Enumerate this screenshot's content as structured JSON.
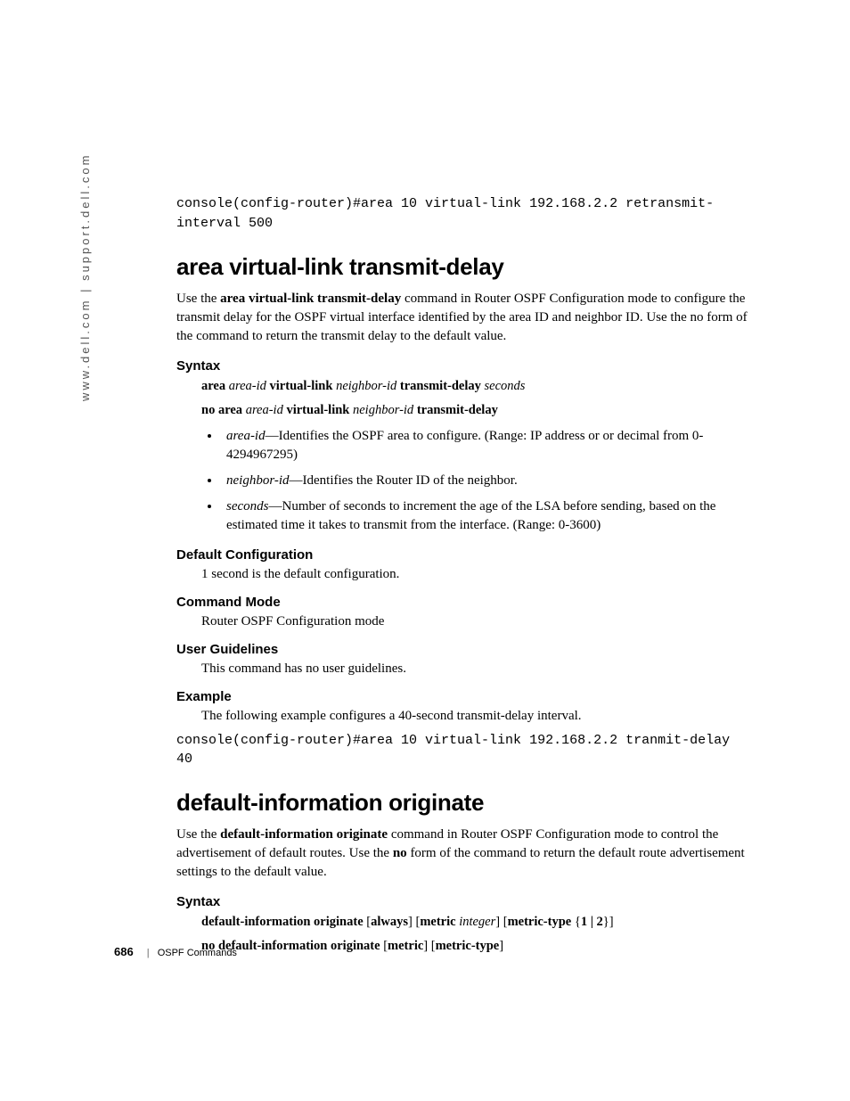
{
  "sidebar": "www.dell.com | support.dell.com",
  "topcode": "console(config-router)#area 10 virtual-link 192.168.2.2 retransmit-interval 500",
  "s1": {
    "title": "area virtual-link transmit-delay",
    "desc_pre": "Use the ",
    "desc_bold": "area virtual-link transmit-delay",
    "desc_post": " command in Router OSPF Configuration mode to configure the transmit delay for the OSPF virtual interface identified by the area ID and neighbor ID. Use the no form of the command to return the transmit delay to the default value.",
    "syntax_h": "Syntax",
    "syn1": {
      "b1": "area ",
      "i1": "area-id",
      "b2": " virtual-link ",
      "i2": "neighbor-id",
      "b3": "  transmit-delay ",
      "i3": "seconds"
    },
    "syn2": {
      "b1": "no area ",
      "i1": "area-id",
      "b2": " virtual-link ",
      "i2": "neighbor-id",
      "b3": "  transmit-delay"
    },
    "bul1": {
      "i": "area-id",
      "t": "—Identifies the OSPF area to configure. (Range: IP address or or decimal from 0-4294967295)"
    },
    "bul2": {
      "i": "neighbor-id",
      "t": "—Identifies the Router ID of the neighbor."
    },
    "bul3": {
      "i": "seconds",
      "t": "—Number of seconds to increment the age of the LSA before sending, based on the estimated time it takes to transmit from the interface. (Range: 0-3600)"
    },
    "defcfg_h": "Default Configuration",
    "defcfg_t": "1 second is the default configuration.",
    "cmdmode_h": "Command Mode",
    "cmdmode_t": "Router OSPF Configuration mode",
    "ug_h": "User Guidelines",
    "ug_t": "This command has no user guidelines.",
    "ex_h": "Example",
    "ex_t": "The following example configures a 40-second transmit-delay interval.",
    "ex_code": "console(config-router)#area 10 virtual-link 192.168.2.2 tranmit-delay 40"
  },
  "s2": {
    "title": "default-information originate",
    "desc_pre": "Use the ",
    "desc_bold": "default-information originate",
    "desc_mid": " command in Router OSPF Configuration mode to control the advertisement of default routes. Use the ",
    "desc_bold2": "no",
    "desc_post": " form of the command to return the default route advertisement settings to the default value.",
    "syntax_h": "Syntax",
    "syn1": {
      "b1": "default-information originate",
      "t1": " [",
      "b2": "always",
      "t2": "] [",
      "b3": "metric ",
      "i1": "integer",
      "t3": "] [",
      "b4": "metric-type",
      "t4": " {",
      "b5": "1 | 2",
      "t5": "}]"
    },
    "syn2": {
      "b1": "no default-information originate",
      "t1": " [",
      "b2": "metric",
      "t2": "] [",
      "b3": "metric-type",
      "t3": "]"
    }
  },
  "footer": {
    "page": "686",
    "section": "OSPF Commands"
  }
}
